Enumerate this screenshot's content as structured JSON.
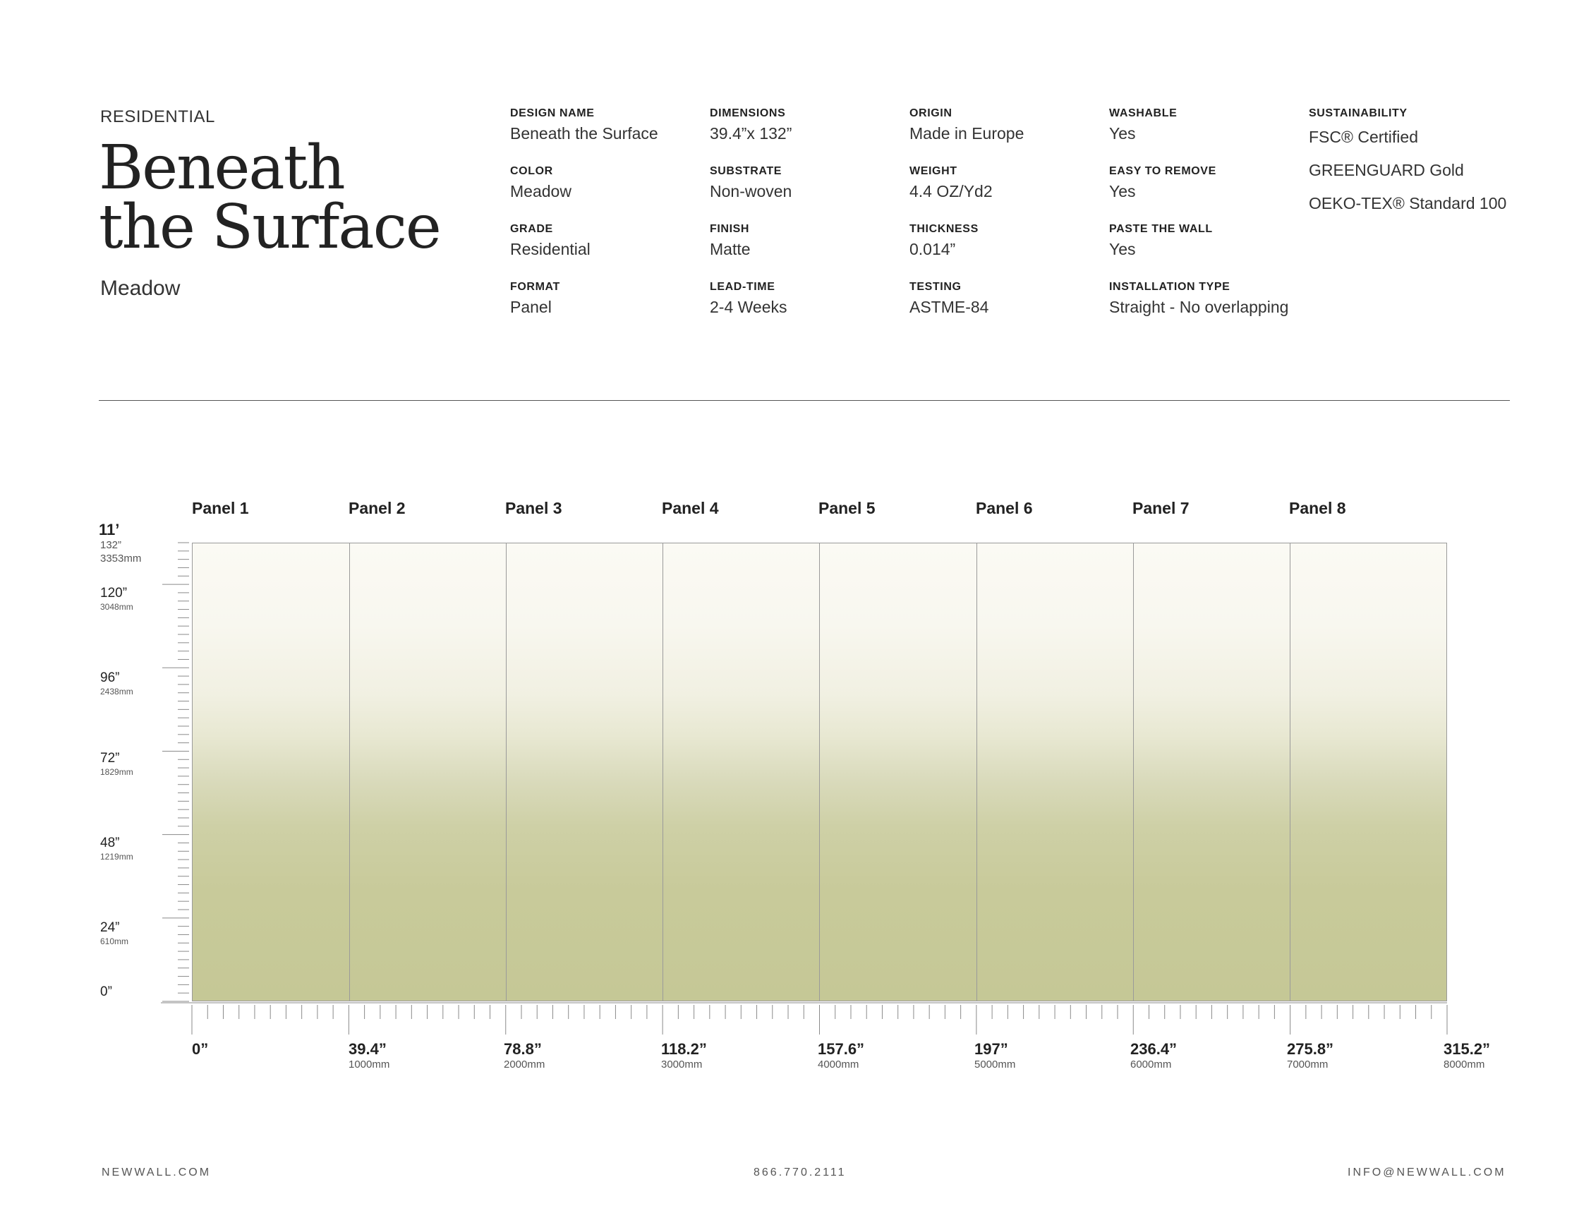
{
  "header": {
    "category": "RESIDENTIAL",
    "title_line1": "Beneath",
    "title_line2": "the Surface",
    "subtitle": "Meadow"
  },
  "specs": [
    {
      "label": "DESIGN NAME",
      "value": "Beneath the Surface"
    },
    {
      "label": "COLOR",
      "value": "Meadow"
    },
    {
      "label": "GRADE",
      "value": "Residential"
    },
    {
      "label": "FORMAT",
      "value": "Panel"
    },
    {
      "label": "DIMENSIONS",
      "value": "39.4”x 132”"
    },
    {
      "label": "SUBSTRATE",
      "value": "Non-woven"
    },
    {
      "label": "FINISH",
      "value": "Matte"
    },
    {
      "label": "LEAD-TIME",
      "value": "2-4 Weeks"
    },
    {
      "label": "ORIGIN",
      "value": "Made in Europe"
    },
    {
      "label": "WEIGHT",
      "value": "4.4 OZ/Yd2"
    },
    {
      "label": "THICKNESS",
      "value": "0.014”"
    },
    {
      "label": "TESTING",
      "value": "ASTME-84"
    },
    {
      "label": "WASHABLE",
      "value": "Yes"
    },
    {
      "label": "EASY TO REMOVE",
      "value": "Yes"
    },
    {
      "label": "PASTE THE WALL",
      "value": "Yes"
    },
    {
      "label": "INSTALLATION TYPE",
      "value": "Straight - No overlapping"
    }
  ],
  "sustainability": {
    "label": "SUSTAINABILITY",
    "items": [
      "FSC® Certified",
      "GREENGUARD Gold",
      "OEKO-TEX® Standard 100"
    ]
  },
  "panels": [
    "Panel 1",
    "Panel 2",
    "Panel 3",
    "Panel 4",
    "Panel 5",
    "Panel 6",
    "Panel 7",
    "Panel 8"
  ],
  "colors": {
    "wall_top": "#fbfaf4",
    "wall_bottom": "#c5c896",
    "rule": "#555555"
  },
  "height_scale": {
    "title": "11’",
    "top_in": "132”",
    "top_mm": "3353mm",
    "marks": [
      {
        "in": "120”",
        "mm": "3048mm"
      },
      {
        "in": "96”",
        "mm": "2438mm"
      },
      {
        "in": "72”",
        "mm": "1829mm"
      },
      {
        "in": "48”",
        "mm": "1219mm"
      },
      {
        "in": "24”",
        "mm": "610mm"
      },
      {
        "in": "0”",
        "mm": ""
      }
    ]
  },
  "width_scale": [
    {
      "in": "0”",
      "mm": ""
    },
    {
      "in": "39.4”",
      "mm": "1000mm"
    },
    {
      "in": "78.8”",
      "mm": "2000mm"
    },
    {
      "in": "118.2”",
      "mm": "3000mm"
    },
    {
      "in": "157.6”",
      "mm": "4000mm"
    },
    {
      "in": "197”",
      "mm": "5000mm"
    },
    {
      "in": "236.4”",
      "mm": "6000mm"
    },
    {
      "in": "275.8”",
      "mm": "7000mm"
    },
    {
      "in": "315.2”",
      "mm": "8000mm"
    }
  ],
  "footer": {
    "website": "NEWWALL.COM",
    "phone": "866.770.2111",
    "email": "INFO@NEWWALL.COM"
  }
}
